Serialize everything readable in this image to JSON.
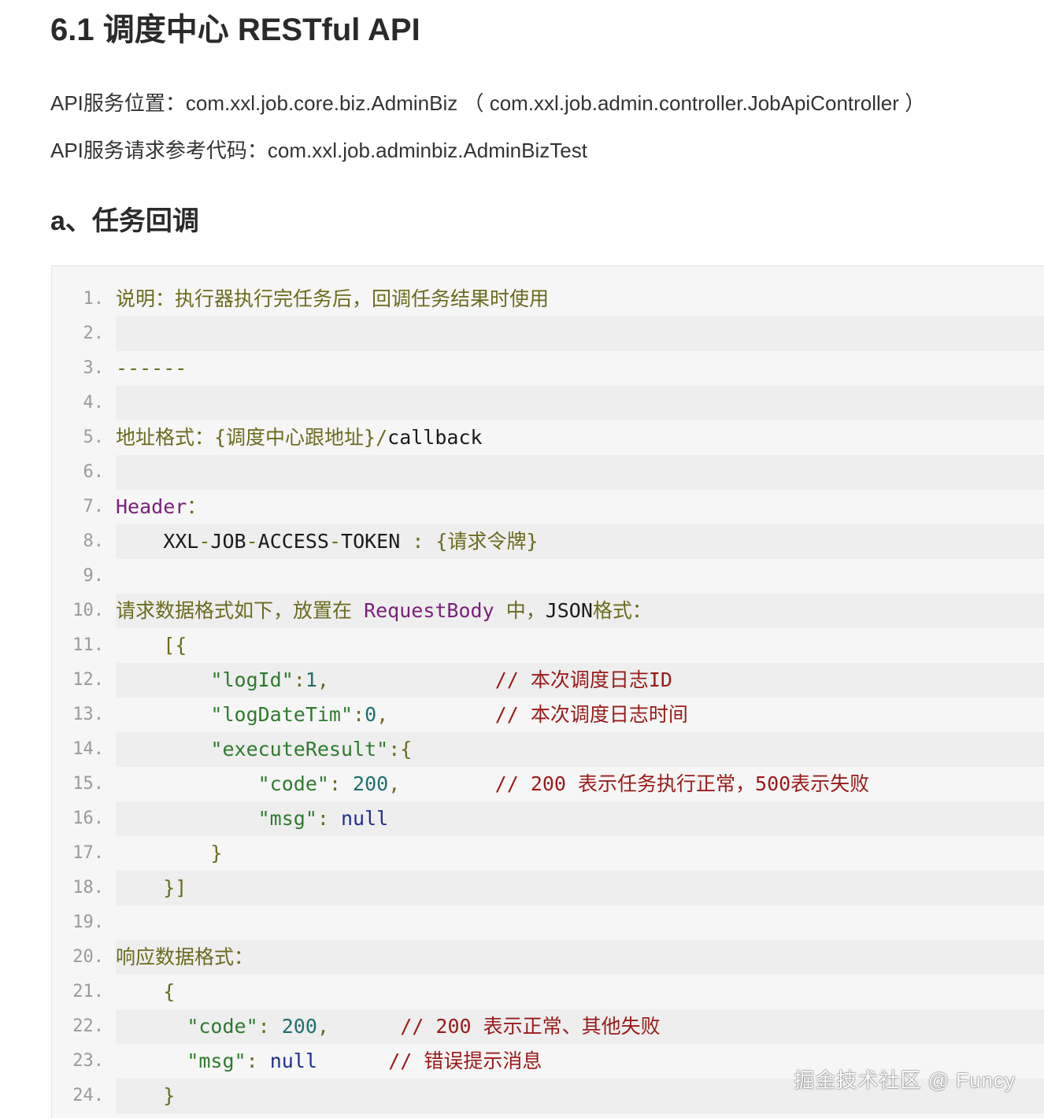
{
  "title": "6.1 调度中心 RESTful API",
  "paragraphs": {
    "p1": "API服务位置：com.xxl.job.core.biz.AdminBiz （ com.xxl.job.admin.controller.JobApiController ）",
    "p2": "API服务请求参考代码：com.xxl.job.adminbiz.AdminBizTest"
  },
  "section_heading": "a、任务回调",
  "code": {
    "lines": [
      {
        "n": "1.",
        "tokens": [
          {
            "t": "说明：执行器执行完任务后，回调任务结果时使用",
            "c": "c-cjk"
          }
        ]
      },
      {
        "n": "2.",
        "tokens": []
      },
      {
        "n": "3.",
        "tokens": [
          {
            "t": "------",
            "c": "c-cjk"
          }
        ]
      },
      {
        "n": "4.",
        "tokens": []
      },
      {
        "n": "5.",
        "tokens": [
          {
            "t": "地址格式：{调度中心跟地址}/",
            "c": "c-cjk"
          },
          {
            "t": "callback",
            "c": "c-plain"
          }
        ]
      },
      {
        "n": "6.",
        "tokens": []
      },
      {
        "n": "7.",
        "tokens": [
          {
            "t": "Header",
            "c": "c-kw"
          },
          {
            "t": "：",
            "c": "c-cjk"
          }
        ]
      },
      {
        "n": "8.",
        "tokens": [
          {
            "t": "    XXL",
            "c": "c-plain"
          },
          {
            "t": "-",
            "c": "c-op"
          },
          {
            "t": "JOB",
            "c": "c-plain"
          },
          {
            "t": "-",
            "c": "c-op"
          },
          {
            "t": "ACCESS",
            "c": "c-plain"
          },
          {
            "t": "-",
            "c": "c-op"
          },
          {
            "t": "TOKEN ",
            "c": "c-plain"
          },
          {
            "t": ": {请求令牌}",
            "c": "c-cjk"
          }
        ]
      },
      {
        "n": "9.",
        "tokens": []
      },
      {
        "n": "10.",
        "tokens": [
          {
            "t": "请求数据格式如下，放置在 ",
            "c": "c-cjk"
          },
          {
            "t": "RequestBody",
            "c": "c-kw"
          },
          {
            "t": " 中，",
            "c": "c-cjk"
          },
          {
            "t": "JSON",
            "c": "c-plain"
          },
          {
            "t": "格式：",
            "c": "c-cjk"
          }
        ]
      },
      {
        "n": "11.",
        "tokens": [
          {
            "t": "    [{",
            "c": "c-cjk"
          }
        ]
      },
      {
        "n": "12.",
        "tokens": [
          {
            "t": "        ",
            "c": "c-plain"
          },
          {
            "t": "\"logId\"",
            "c": "c-str"
          },
          {
            "t": ":",
            "c": "c-cjk"
          },
          {
            "t": "1",
            "c": "c-num"
          },
          {
            "t": ",              ",
            "c": "c-cjk"
          },
          {
            "t": "// 本次调度日志ID",
            "c": "c-com"
          }
        ]
      },
      {
        "n": "13.",
        "tokens": [
          {
            "t": "        ",
            "c": "c-plain"
          },
          {
            "t": "\"logDateTim\"",
            "c": "c-str"
          },
          {
            "t": ":",
            "c": "c-cjk"
          },
          {
            "t": "0",
            "c": "c-num"
          },
          {
            "t": ",         ",
            "c": "c-cjk"
          },
          {
            "t": "// 本次调度日志时间",
            "c": "c-com"
          }
        ]
      },
      {
        "n": "14.",
        "tokens": [
          {
            "t": "        ",
            "c": "c-plain"
          },
          {
            "t": "\"executeResult\"",
            "c": "c-str"
          },
          {
            "t": ":{",
            "c": "c-cjk"
          }
        ]
      },
      {
        "n": "15.",
        "tokens": [
          {
            "t": "            ",
            "c": "c-plain"
          },
          {
            "t": "\"code\"",
            "c": "c-str"
          },
          {
            "t": ": ",
            "c": "c-cjk"
          },
          {
            "t": "200",
            "c": "c-num"
          },
          {
            "t": ",        ",
            "c": "c-cjk"
          },
          {
            "t": "// 200 表示任务执行正常，500表示失败",
            "c": "c-com"
          }
        ]
      },
      {
        "n": "16.",
        "tokens": [
          {
            "t": "            ",
            "c": "c-plain"
          },
          {
            "t": "\"msg\"",
            "c": "c-str"
          },
          {
            "t": ": ",
            "c": "c-cjk"
          },
          {
            "t": "null",
            "c": "c-null"
          }
        ]
      },
      {
        "n": "17.",
        "tokens": [
          {
            "t": "        }",
            "c": "c-cjk"
          }
        ]
      },
      {
        "n": "18.",
        "tokens": [
          {
            "t": "    }]",
            "c": "c-cjk"
          }
        ]
      },
      {
        "n": "19.",
        "tokens": []
      },
      {
        "n": "20.",
        "tokens": [
          {
            "t": "响应数据格式：",
            "c": "c-cjk"
          }
        ]
      },
      {
        "n": "21.",
        "tokens": [
          {
            "t": "    {",
            "c": "c-cjk"
          }
        ]
      },
      {
        "n": "22.",
        "tokens": [
          {
            "t": "      ",
            "c": "c-plain"
          },
          {
            "t": "\"code\"",
            "c": "c-str"
          },
          {
            "t": ": ",
            "c": "c-cjk"
          },
          {
            "t": "200",
            "c": "c-num"
          },
          {
            "t": ",      ",
            "c": "c-cjk"
          },
          {
            "t": "// 200 表示正常、其他失败",
            "c": "c-com"
          }
        ]
      },
      {
        "n": "23.",
        "tokens": [
          {
            "t": "      ",
            "c": "c-plain"
          },
          {
            "t": "\"msg\"",
            "c": "c-str"
          },
          {
            "t": ": ",
            "c": "c-cjk"
          },
          {
            "t": "null",
            "c": "c-null"
          },
          {
            "t": "      ",
            "c": "c-plain"
          },
          {
            "t": "// 错误提示消息",
            "c": "c-com"
          }
        ]
      },
      {
        "n": "24.",
        "tokens": [
          {
            "t": "    }",
            "c": "c-cjk"
          }
        ]
      }
    ]
  },
  "watermark": "掘金技术社区 @ Funcy",
  "colors": {
    "code_background": "#f6f6f6",
    "stripe": "#eeeeee",
    "chinese_text": "#6b6b1f",
    "keyword": "#7a1f7a",
    "string": "#2f7a2f",
    "number": "#1f6f6f",
    "comment": "#9a1a1a",
    "null": "#1f2e8f"
  }
}
